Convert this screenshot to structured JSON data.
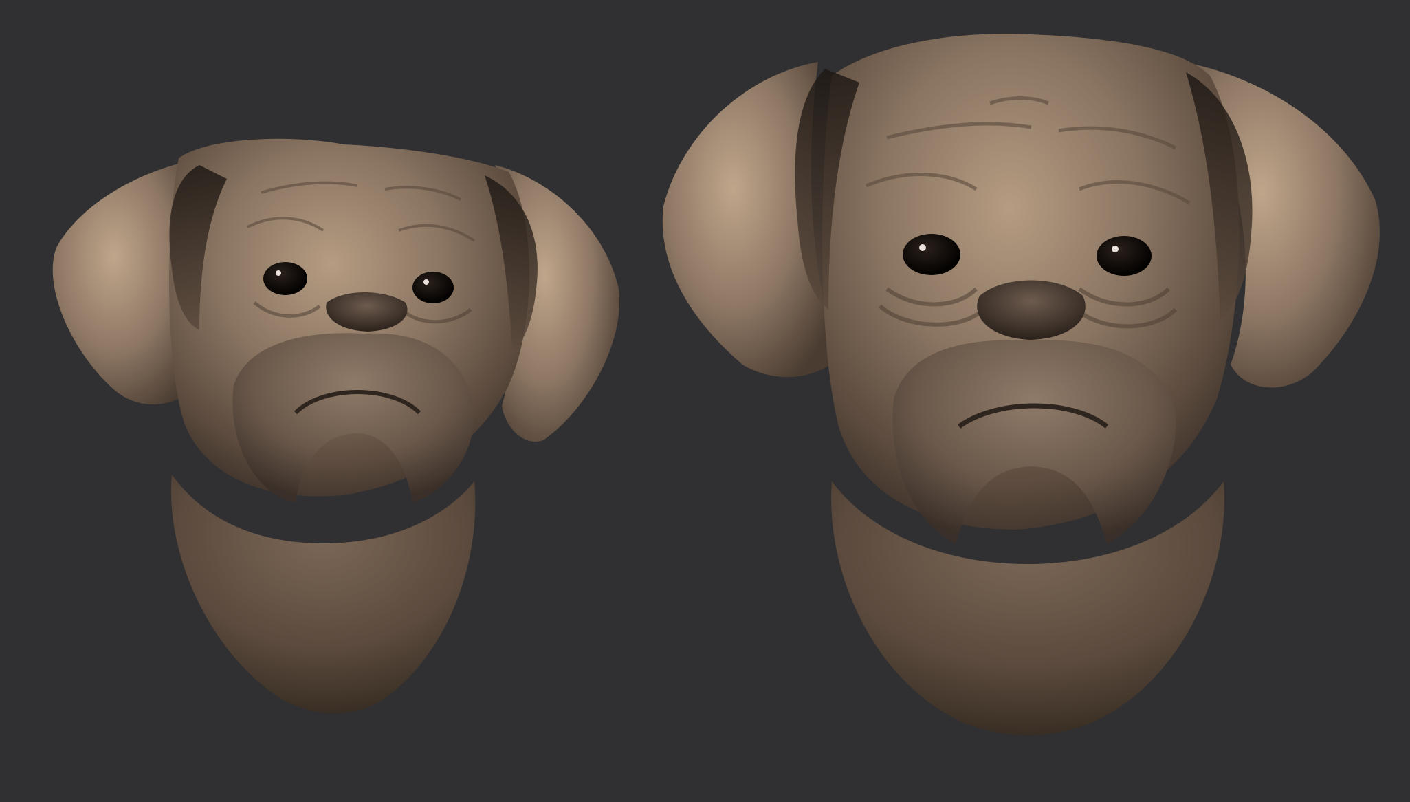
{
  "scene": {
    "background_color": "#303032",
    "material_color": "#8a7562",
    "material_highlight": "#c7af95",
    "material_shadow": "#3a2f27",
    "eye_color": "#0e0a08",
    "models": [
      {
        "id": "left-bust",
        "description_icon": "dog-head-sculpt-icon"
      },
      {
        "id": "right-bust",
        "description_icon": "dog-head-sculpt-icon"
      }
    ]
  }
}
